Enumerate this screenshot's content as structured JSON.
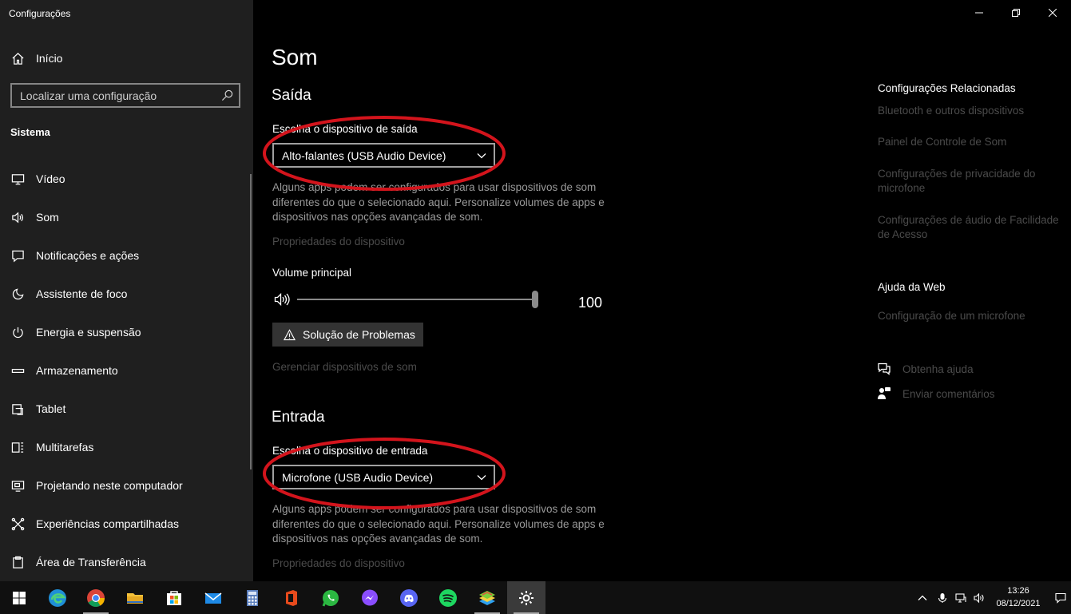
{
  "app": {
    "title": "Configurações"
  },
  "window_controls": {
    "minimize": "minimize-icon",
    "restore": "restore-icon",
    "close": "close-icon"
  },
  "sidebar": {
    "home": "Início",
    "search_placeholder": "Localizar uma configuração",
    "section": "Sistema",
    "items": [
      {
        "label": "Vídeo",
        "icon": "display-icon"
      },
      {
        "label": "Som",
        "icon": "speaker-icon"
      },
      {
        "label": "Notificações e ações",
        "icon": "notification-icon"
      },
      {
        "label": "Assistente de foco",
        "icon": "moon-icon"
      },
      {
        "label": "Energia e suspensão",
        "icon": "power-icon"
      },
      {
        "label": "Armazenamento",
        "icon": "storage-icon"
      },
      {
        "label": "Tablet",
        "icon": "tablet-icon"
      },
      {
        "label": "Multitarefas",
        "icon": "multitask-icon"
      },
      {
        "label": "Projetando neste computador",
        "icon": "projecting-icon"
      },
      {
        "label": "Experiências compartilhadas",
        "icon": "shared-icon"
      },
      {
        "label": "Área de Transferência",
        "icon": "clipboard-icon"
      }
    ]
  },
  "main": {
    "title": "Som",
    "output": {
      "heading": "Saída",
      "choose_label": "Escolha o dispositivo de saída",
      "device": "Alto-falantes (USB Audio Device)",
      "description": "Alguns apps podem ser configurados para usar dispositivos de som diferentes do que o selecionado aqui. Personalize volumes de apps e dispositivos nas opções avançadas de som.",
      "properties_link": "Propriedades do dispositivo",
      "volume_label": "Volume principal",
      "volume_value": "100",
      "volume_level": 100,
      "troubleshoot": "Solução de Problemas",
      "manage_link": "Gerenciar dispositivos de som"
    },
    "input": {
      "heading": "Entrada",
      "choose_label": "Escolha o dispositivo de entrada",
      "device": "Microfone (USB Audio Device)",
      "description": "Alguns apps podem ser configurados para usar dispositivos de som diferentes do que o selecionado aqui. Personalize volumes de apps e dispositivos nas opções avançadas de som.",
      "properties_link": "Propriedades do dispositivo"
    },
    "annotation_color": "#d3141c"
  },
  "right_panel": {
    "related_heading": "Configurações Relacionadas",
    "related_links": [
      "Bluetooth e outros dispositivos",
      "Painel de Controle de Som",
      "Configurações de privacidade do microfone",
      "Configurações de áudio de Facilidade de Acesso"
    ],
    "web_heading": "Ajuda da Web",
    "web_links": [
      "Configuração de um microfone"
    ],
    "get_help": "Obtenha ajuda",
    "feedback": "Enviar comentários"
  },
  "taskbar": {
    "apps": [
      "windows-start-icon",
      "edge-icon",
      "chrome-icon",
      "file-explorer-icon",
      "microsoft-store-icon",
      "mail-icon",
      "calculator-icon",
      "office-icon",
      "whatsapp-icon",
      "messenger-icon",
      "discord-icon",
      "spotify-icon",
      "bluestacks-icon",
      "settings-icon"
    ],
    "time": "13:26",
    "date": "08/12/2021"
  }
}
